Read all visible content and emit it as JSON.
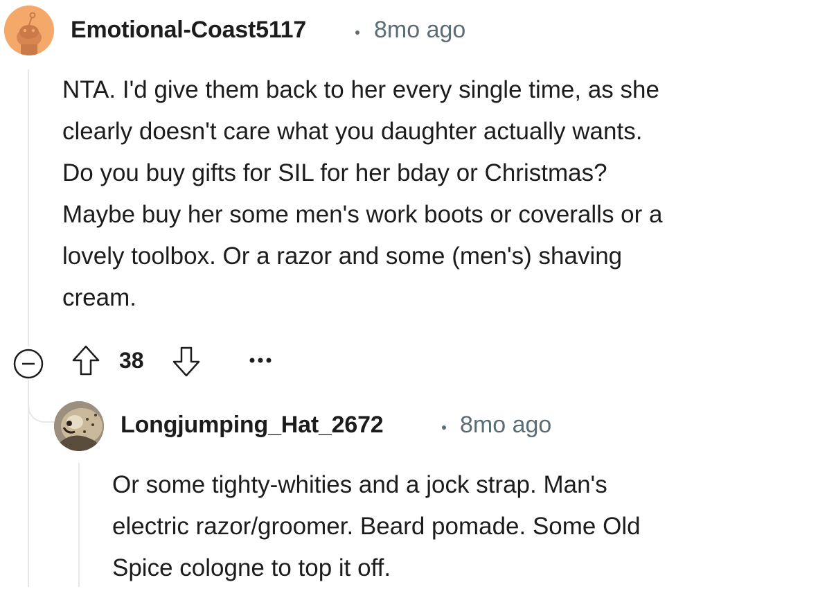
{
  "comments": [
    {
      "username": "Emotional-Coast5117",
      "separator": "·",
      "time": "8mo ago",
      "body_lines": [
        "NTA. I'd give them back to her every single time, as she",
        "clearly doesn't care what you daughter actually wants.",
        "Do you buy gifts for SIL for her bday or Christmas?",
        "Maybe buy her some men's work boots or coveralls or a",
        "lovely toolbox. Or a razor and some (men's) shaving",
        "cream."
      ],
      "votes": "38",
      "avatar_icon": "snoo-avatar-icon",
      "avatar_color": "#f4a86a"
    },
    {
      "username": "Longjumping_Hat_2672",
      "separator": "·",
      "time": "8mo ago",
      "body_lines": [
        "Or some tighty-whities and a jock strap. Man's",
        "electric razor/groomer. Beard pomade. Some Old",
        "Spice cologne to top it off."
      ],
      "avatar_icon": "cheetah-photo-avatar-icon"
    }
  ],
  "icons": {
    "collapse": "collapse-minus-icon",
    "upvote": "upvote-arrow-icon",
    "downvote": "downvote-arrow-icon",
    "more": "more-options-icon"
  },
  "colors": {
    "text": "#1c1c1c",
    "meta": "#5c6c74",
    "thread_line": "#e5e7ea",
    "icon": "#1c1c1c"
  }
}
